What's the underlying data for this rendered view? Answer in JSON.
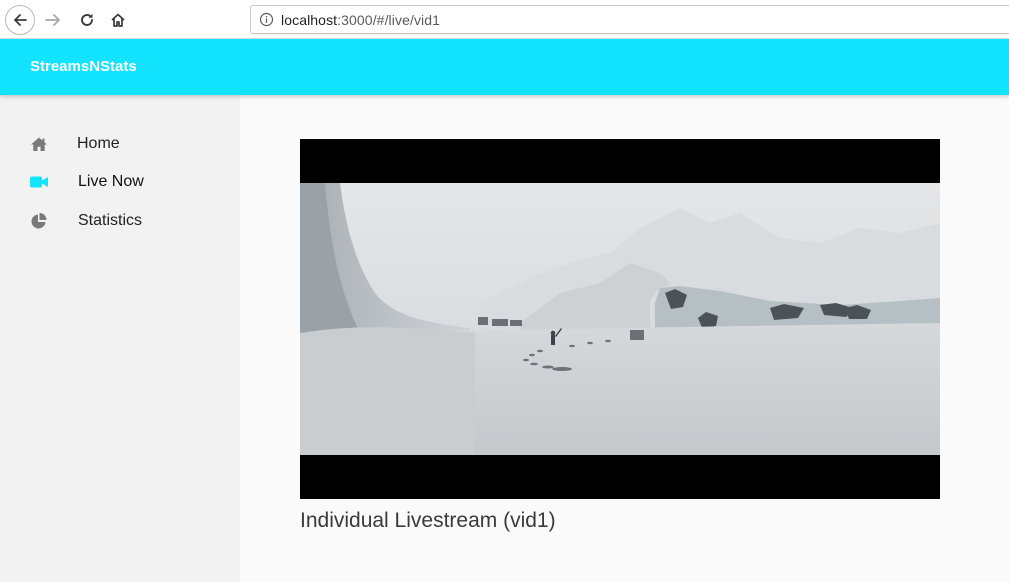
{
  "browser": {
    "url_host": "localhost",
    "url_rest": ":3000/#/live/vid1"
  },
  "header": {
    "brand": "StreamsNStats",
    "accent_color": "#12e3ff"
  },
  "sidebar": {
    "items": [
      {
        "label": "Home",
        "icon": "home-icon",
        "active": false
      },
      {
        "label": "Live Now",
        "icon": "video-camera-icon",
        "active": true
      },
      {
        "label": "Statistics",
        "icon": "pie-chart-icon",
        "active": false
      }
    ]
  },
  "main": {
    "stream_title": "Individual Livestream (vid1)"
  }
}
